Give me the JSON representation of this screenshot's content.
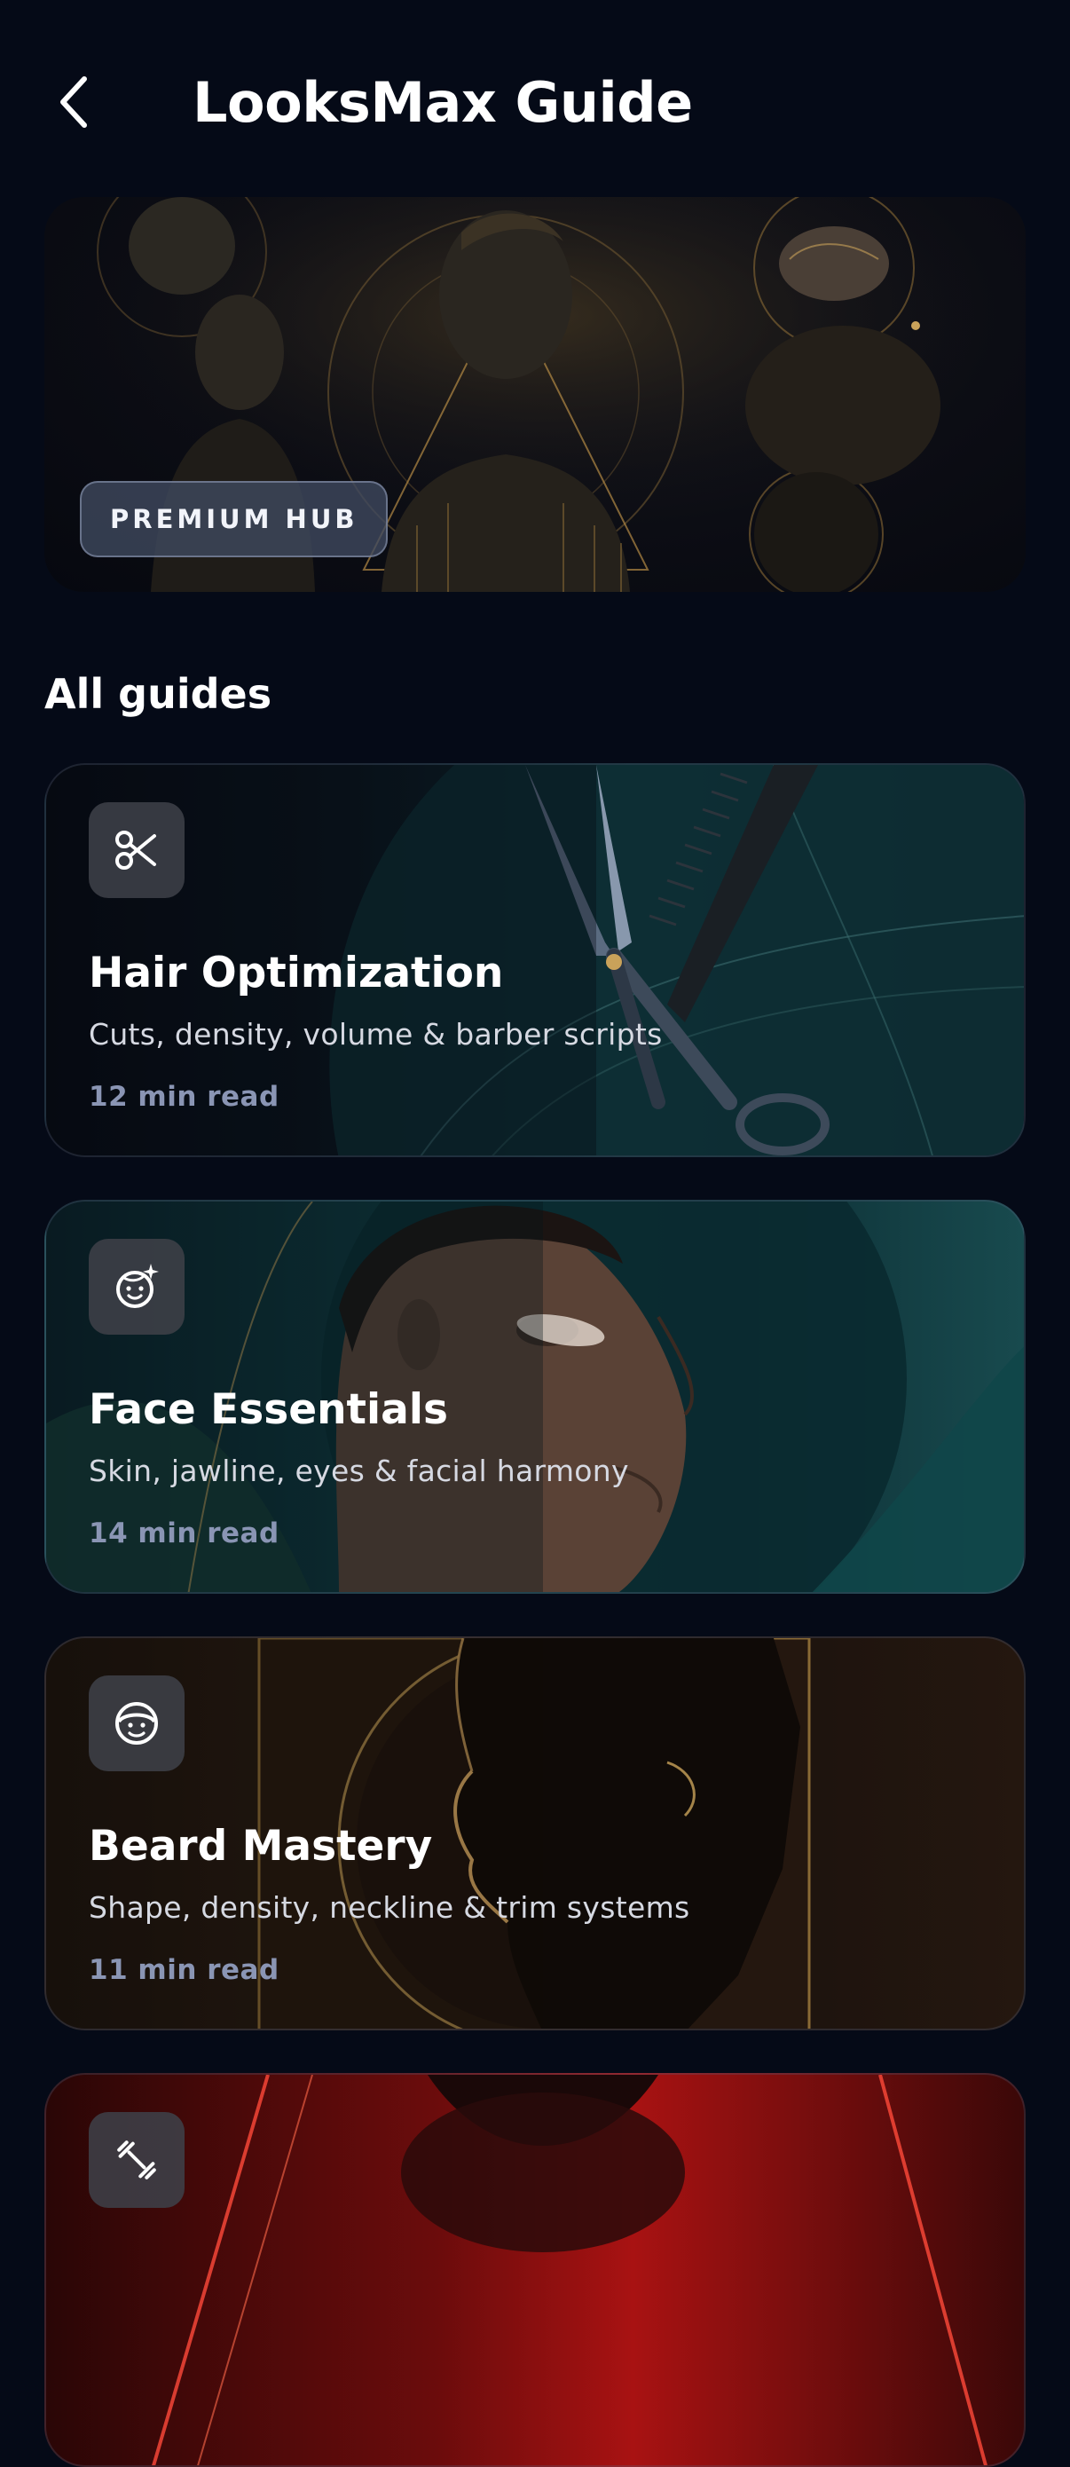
{
  "header": {
    "title": "LooksMax Guide"
  },
  "hero": {
    "badge": "PREMIUM HUB"
  },
  "section": {
    "title": "All guides"
  },
  "guides": [
    {
      "title": "Hair Optimization",
      "description": "Cuts, density, volume & barber scripts",
      "read_time": "12 min read",
      "icon": "scissors-icon"
    },
    {
      "title": "Face Essentials",
      "description": "Skin, jawline, eyes & facial harmony",
      "read_time": "14 min read",
      "icon": "face-sparkle-icon"
    },
    {
      "title": "Beard Mastery",
      "description": "Shape, density, neckline & trim systems",
      "read_time": "11 min read",
      "icon": "face-icon"
    },
    {
      "title": "",
      "description": "",
      "read_time": "",
      "icon": "dumbbell-icon"
    }
  ],
  "colors": {
    "background": "#050a17",
    "accent_gold": "#c9a25a",
    "read_time": "#8a95b4"
  }
}
